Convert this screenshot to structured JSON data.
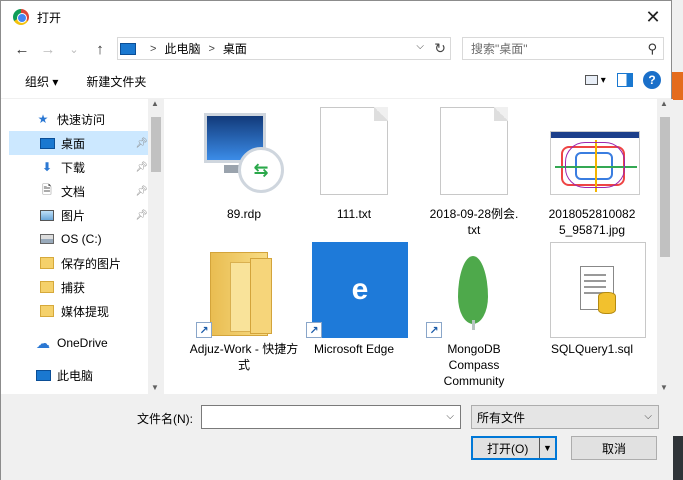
{
  "window": {
    "title": "打开",
    "close_glyph": "✕"
  },
  "nav": {
    "back": "←",
    "forward": "→",
    "recent": "⌄",
    "up": "↑",
    "breadcrumb": [
      "此电脑",
      "桌面"
    ],
    "separator": ">",
    "search_placeholder": "搜索\"桌面\""
  },
  "toolbar": {
    "organize": "组织 ▾",
    "new_folder": "新建文件夹",
    "help": "?"
  },
  "sidebar": {
    "items": [
      {
        "label": "快速访问",
        "icon": "star-icon",
        "pinned": false
      },
      {
        "label": "桌面",
        "icon": "desktop-icon",
        "pinned": true,
        "selected": true
      },
      {
        "label": "下载",
        "icon": "download-icon",
        "pinned": true
      },
      {
        "label": "文档",
        "icon": "document-icon",
        "pinned": true
      },
      {
        "label": "图片",
        "icon": "pictures-icon",
        "pinned": true
      },
      {
        "label": "OS (C:)",
        "icon": "drive-icon",
        "pinned": false
      },
      {
        "label": "保存的图片",
        "icon": "folder-icon",
        "pinned": false
      },
      {
        "label": "捕获",
        "icon": "folder-icon",
        "pinned": false
      },
      {
        "label": "媒体提现",
        "icon": "folder-icon",
        "pinned": false
      },
      {
        "label": "OneDrive",
        "icon": "cloud-icon",
        "pinned": false
      },
      {
        "label": "此电脑",
        "icon": "computer-icon",
        "pinned": false
      }
    ]
  },
  "files": [
    {
      "name": "89.rdp",
      "icon": "remote-desktop-icon"
    },
    {
      "name": "111.txt",
      "icon": "text-file-icon"
    },
    {
      "name": "2018-09-28例会.txt",
      "icon": "text-file-icon"
    },
    {
      "name": "20180528100825_95871.jpg",
      "icon": "image-file-icon"
    },
    {
      "name": "Adjuz-Work - 快捷方式",
      "icon": "folder-shortcut-icon"
    },
    {
      "name": "Microsoft Edge",
      "icon": "edge-icon"
    },
    {
      "name": "MongoDB Compass Community",
      "icon": "mongodb-icon"
    },
    {
      "name": "SQLQuery1.sql",
      "icon": "sql-file-icon"
    }
  ],
  "bottom": {
    "filename_label": "文件名(N):",
    "filename_value": "",
    "filetype": "所有文件",
    "open_label": "打开(O)",
    "cancel_label": "取消"
  },
  "colors": {
    "accent": "#0078d7",
    "selected_bg": "#cce8ff",
    "edge_blue": "#1e7ad9"
  }
}
